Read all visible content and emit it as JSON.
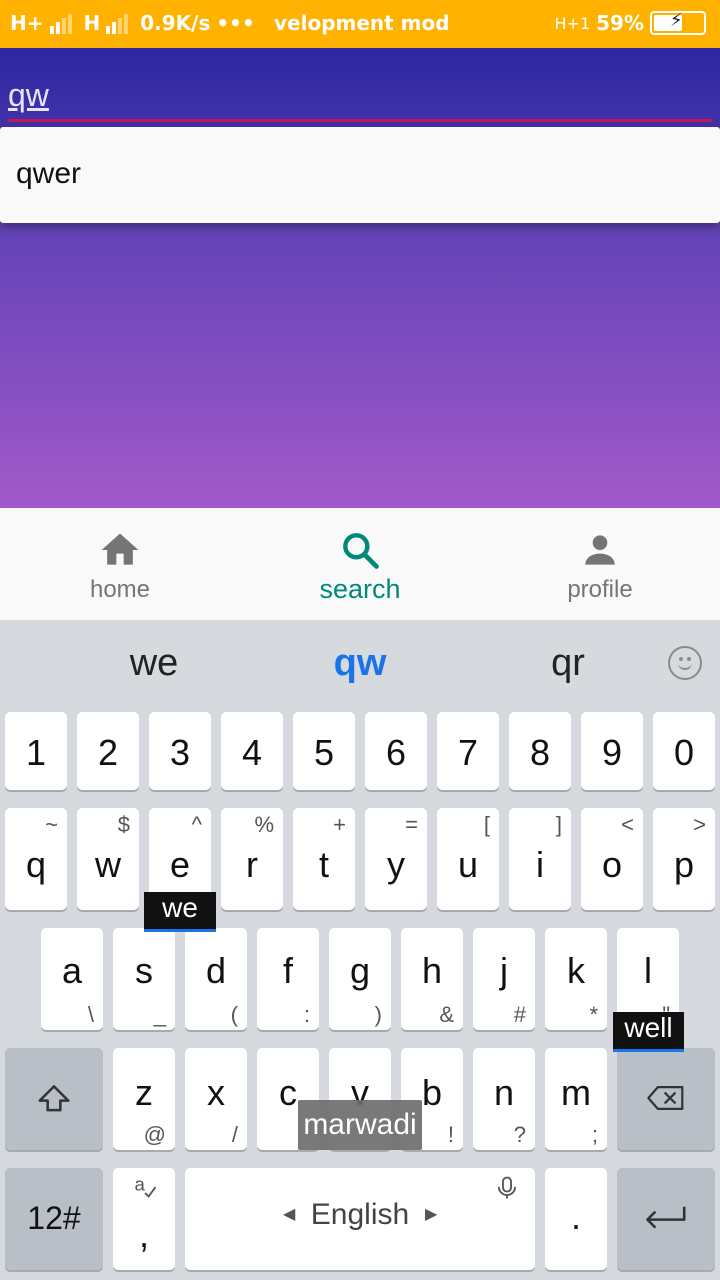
{
  "status_bar": {
    "network1": "H+",
    "network2": "H",
    "speed": "0.9K/s",
    "dots": "•••",
    "notification": "velopment mod",
    "network3": "H+1",
    "battery_percent": "59%",
    "battery_level": 0.59
  },
  "search": {
    "value": "qw",
    "suggestions": [
      "qwer"
    ]
  },
  "nav": {
    "items": [
      {
        "label": "home",
        "icon": "home-icon"
      },
      {
        "label": "search",
        "icon": "search-icon"
      },
      {
        "label": "profile",
        "icon": "person-icon"
      }
    ],
    "active": "search",
    "active_color": "#00897b",
    "inactive_color": "#757575"
  },
  "keyboard": {
    "suggestions": [
      "we",
      "qw",
      "qr"
    ],
    "highlight_color": "#1a73e8",
    "numbers": [
      "1",
      "2",
      "3",
      "4",
      "5",
      "6",
      "7",
      "8",
      "9",
      "0"
    ],
    "row2": [
      {
        "k": "q",
        "s": "~"
      },
      {
        "k": "w",
        "s": "$"
      },
      {
        "k": "e",
        "s": "^"
      },
      {
        "k": "r",
        "s": "%"
      },
      {
        "k": "t",
        "s": "+"
      },
      {
        "k": "y",
        "s": "="
      },
      {
        "k": "u",
        "s": "["
      },
      {
        "k": "i",
        "s": "]"
      },
      {
        "k": "o",
        "s": "<"
      },
      {
        "k": "p",
        "s": ">"
      }
    ],
    "row3": [
      {
        "k": "a",
        "s": "\\"
      },
      {
        "k": "s",
        "s": "_"
      },
      {
        "k": "d",
        "s": "("
      },
      {
        "k": "f",
        "s": ":"
      },
      {
        "k": "g",
        "s": ")"
      },
      {
        "k": "h",
        "s": "&"
      },
      {
        "k": "j",
        "s": "#"
      },
      {
        "k": "k",
        "s": "*"
      },
      {
        "k": "l",
        "s": "\""
      }
    ],
    "row4": [
      {
        "k": "z",
        "s": "@"
      },
      {
        "k": "x",
        "s": "/"
      },
      {
        "k": "c",
        "s": ""
      },
      {
        "k": "v",
        "s": ""
      },
      {
        "k": "b",
        "s": "!"
      },
      {
        "k": "n",
        "s": "?"
      },
      {
        "k": "m",
        "s": ";"
      }
    ],
    "popup_e": "we",
    "popup_l": "well",
    "floating_hint": "marwadi",
    "symbols_key": "12#",
    "comma_key": ",",
    "space_label": "English",
    "period_key": "."
  }
}
